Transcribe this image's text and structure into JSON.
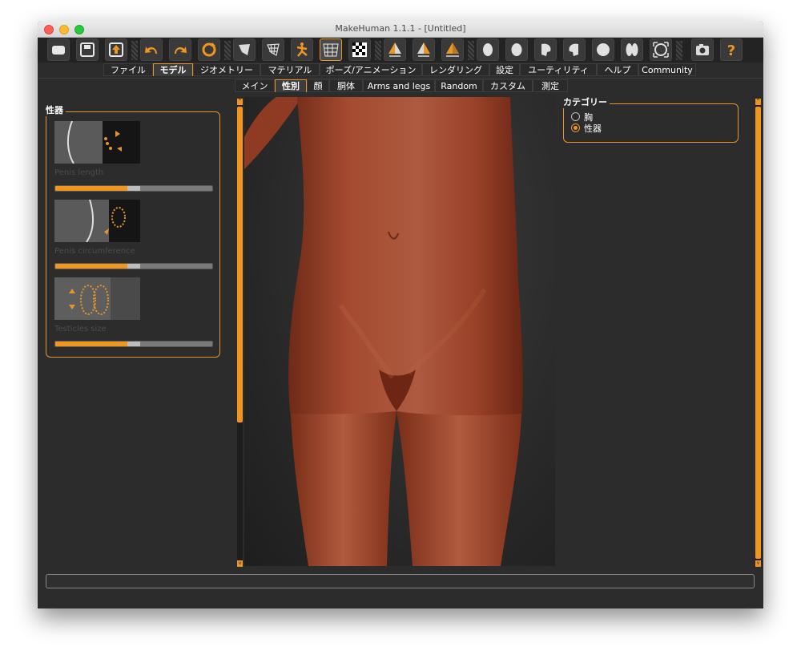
{
  "window": {
    "title": "MakeHuman 1.1.1 - [Untitled]"
  },
  "toolbar": {
    "icons": [
      "new-file-icon",
      "save-icon",
      "export-icon",
      "undo-icon",
      "redo-icon",
      "reset-icon",
      "smooth-icon",
      "wireframe-icon",
      "pose-icon",
      "grid-icon",
      "checker-icon",
      "front-view-icon",
      "back-view-icon",
      "side-view-icon",
      "face-icon",
      "head-icon",
      "left-side-icon",
      "right-side-icon",
      "top-view-icon",
      "bottom-view-icon",
      "frame-icon",
      "screenshot-icon",
      "help-icon"
    ],
    "accent": "#f0961e"
  },
  "main_tabs": [
    "ファイル",
    "モデル",
    "ジオメトリー",
    "マテリアル",
    "ポーズ/アニメーション",
    "レンダリング",
    "設定",
    "ユーティリティ",
    "ヘルプ",
    "Community"
  ],
  "main_tab_active": "モデル",
  "sub_tabs": [
    "メイン",
    "性別",
    "顔",
    "胴体",
    "Arms and legs",
    "Random",
    "カスタム",
    "測定"
  ],
  "sub_tab_active": "性別",
  "left_panel": {
    "group_title": "性器",
    "sliders": [
      {
        "label": "Penis length",
        "value": 0.5
      },
      {
        "label": "Penis circumference",
        "value": 0.5
      },
      {
        "label": "Testicles size",
        "value": 0.5
      }
    ]
  },
  "right_panel": {
    "group_title": "カテゴリー",
    "options": [
      {
        "label": "胸",
        "selected": false
      },
      {
        "label": "性器",
        "selected": true
      }
    ]
  },
  "status": {
    "text": ""
  }
}
